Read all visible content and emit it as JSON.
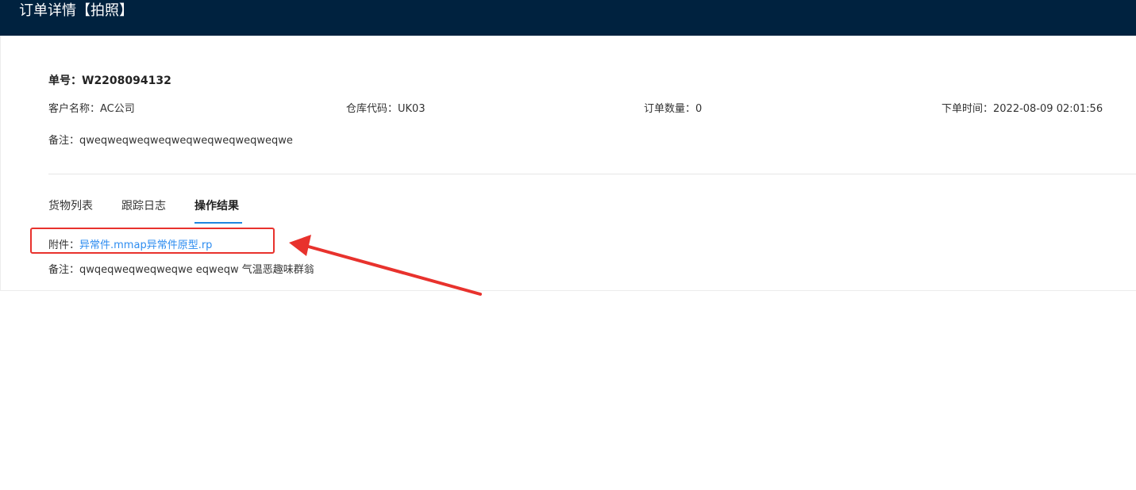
{
  "header": {
    "title": "订单详情【拍照】"
  },
  "order": {
    "number_label": "单号：",
    "number_value": "W2208094132",
    "customer_label": "客户名称：",
    "customer_value": "AC公司",
    "warehouse_label": "仓库代码：",
    "warehouse_value": "UK03",
    "quantity_label": "订单数量：",
    "quantity_value": "0",
    "order_time_label": "下单时间：",
    "order_time_value": "2022-08-09 02:01:56",
    "remark_label": "备注：",
    "remark_value": "qweqweqweqweqweqweqweqweqweqwe"
  },
  "tabs": [
    {
      "label": "货物列表"
    },
    {
      "label": "跟踪日志"
    },
    {
      "label": "操作结果"
    }
  ],
  "result": {
    "attachment_label": "附件：",
    "attachment_files": [
      "异常件.mmap",
      "异常件原型.rp"
    ],
    "remark_label": "备注：",
    "remark_value": "qwqeqweqweqweqwe eqweqw 气温恶趣味群翁"
  },
  "colors": {
    "header_bg": "#00223f",
    "link": "#2d8cf0",
    "tab_active_underline": "#1f86e0",
    "annotation_red": "#e8322d"
  }
}
